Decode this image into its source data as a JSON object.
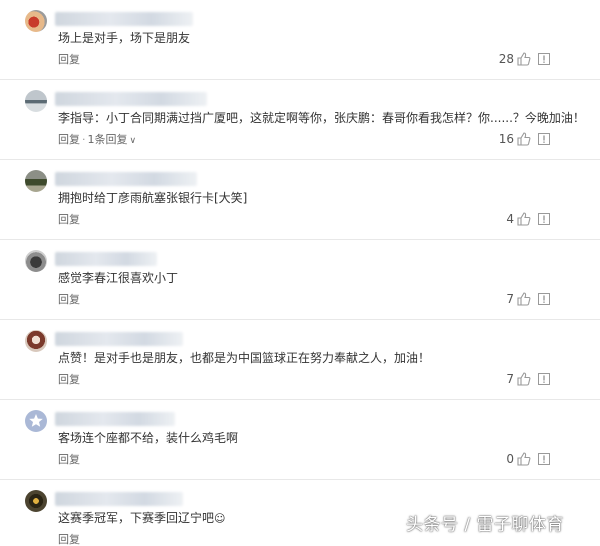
{
  "comments": [
    {
      "text": "场上是对手，场下是朋友",
      "reply": "回复",
      "replies": "",
      "likes": "28"
    },
    {
      "text": "李指导：小丁合同期满过挡广厦吧，这就定啊等你，张庆鹏：春哥你看我怎样？你......？今晚加油！",
      "reply": "回复",
      "replies": "1条回复",
      "likes": "16"
    },
    {
      "text": "拥抱时给丁彦雨航塞张银行卡[大笑]",
      "reply": "回复",
      "replies": "",
      "likes": "4"
    },
    {
      "text": "感觉李春江很喜欢小丁",
      "reply": "回复",
      "replies": "",
      "likes": "7"
    },
    {
      "text": "点赞！是对手也是朋友，也都是为中国篮球正在努力奉献之人，加油！",
      "reply": "回复",
      "replies": "",
      "likes": "7"
    },
    {
      "text": "客场连个座都不给，装什么鸡毛啊",
      "reply": "回复",
      "replies": "",
      "likes": "0"
    },
    {
      "text": "这赛季冠军，下赛季回辽宁吧",
      "reply": "回复",
      "replies": "",
      "likes": ""
    }
  ],
  "watermark": "头条号 / 雷子聊体育"
}
